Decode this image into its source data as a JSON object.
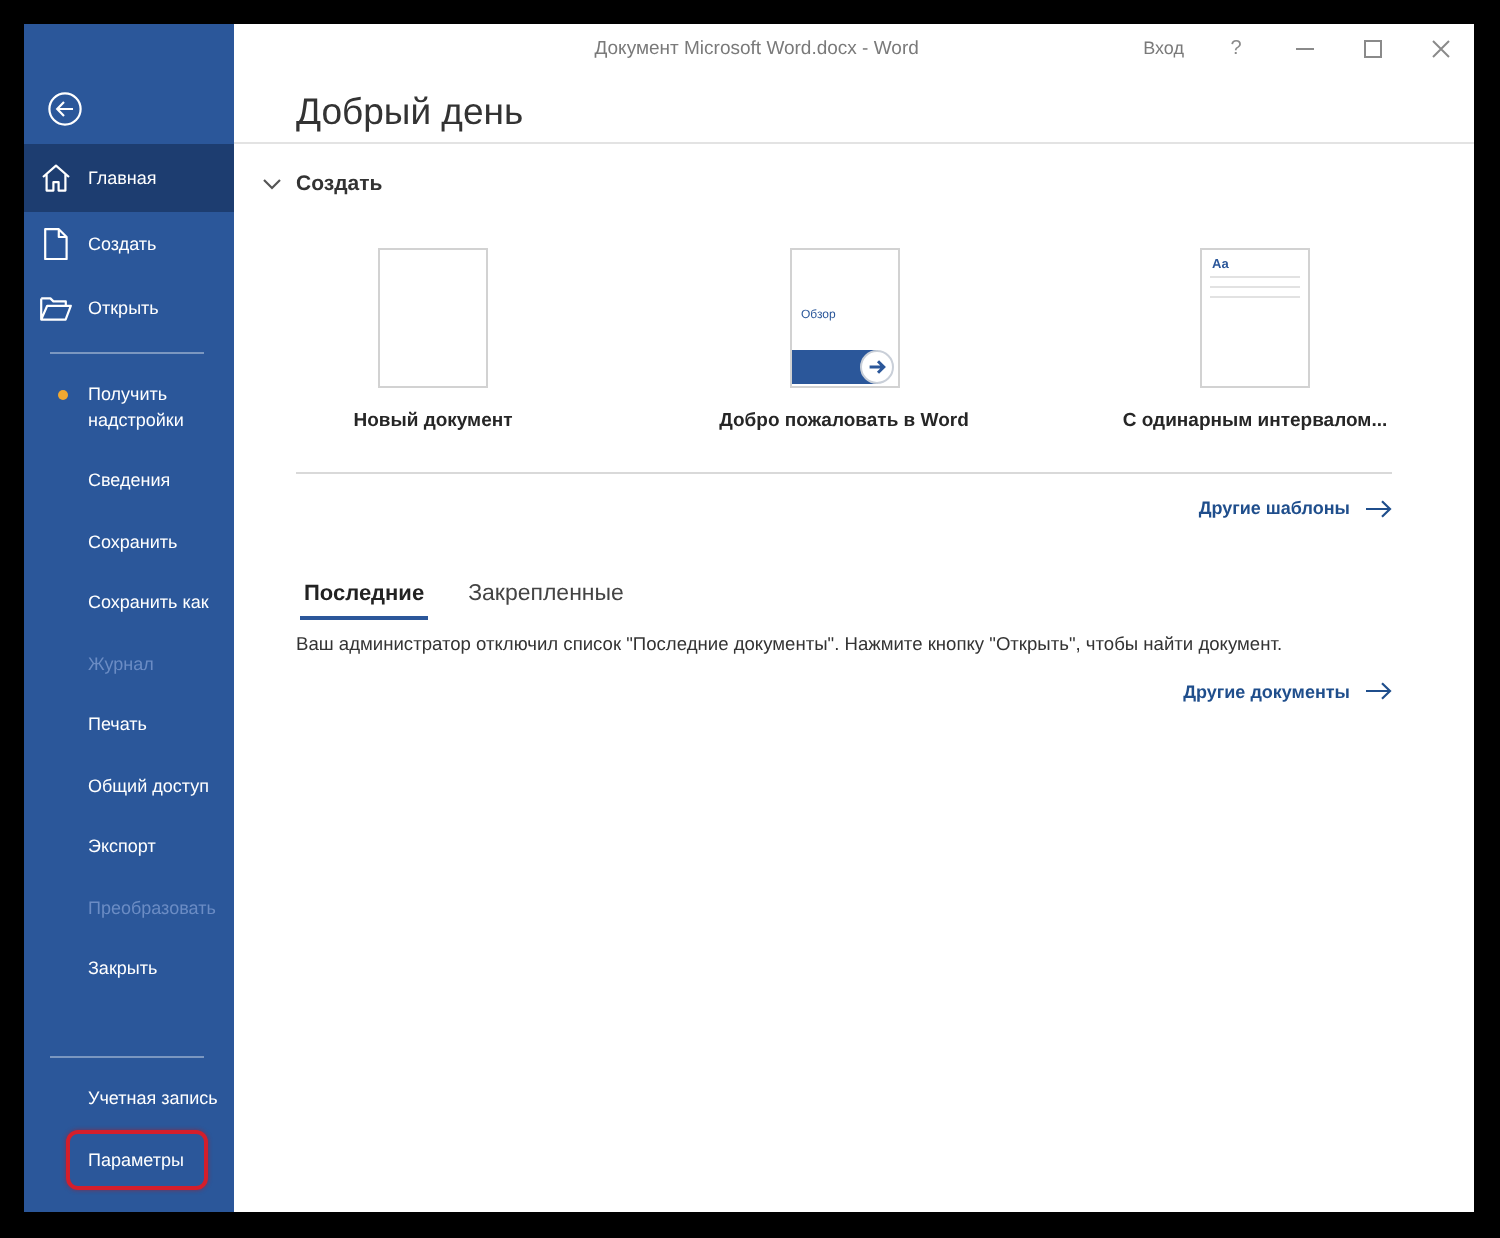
{
  "window": {
    "title": "Документ Microsoft Word.docx - Word",
    "sign_in": "Вход",
    "help": "?"
  },
  "sidebar": {
    "groups": [
      [
        {
          "label": "Главная",
          "kind": "home",
          "selected": true,
          "disabled": false
        },
        {
          "label": "Создать",
          "kind": "new",
          "selected": false,
          "disabled": false
        },
        {
          "label": "Открыть",
          "kind": "open",
          "selected": false,
          "disabled": false
        }
      ],
      [
        {
          "label": "Получить надстройки",
          "kind": "dot",
          "selected": false,
          "disabled": false
        },
        {
          "label": "Сведения",
          "kind": "plain",
          "selected": false,
          "disabled": false
        },
        {
          "label": "Сохранить",
          "kind": "plain",
          "selected": false,
          "disabled": false
        },
        {
          "label": "Сохранить как",
          "kind": "plain",
          "selected": false,
          "disabled": false
        },
        {
          "label": "Журнал",
          "kind": "plain",
          "selected": false,
          "disabled": true
        },
        {
          "label": "Печать",
          "kind": "plain",
          "selected": false,
          "disabled": false
        },
        {
          "label": "Общий доступ",
          "kind": "plain",
          "selected": false,
          "disabled": false
        },
        {
          "label": "Экспорт",
          "kind": "plain",
          "selected": false,
          "disabled": false
        },
        {
          "label": "Преобразовать",
          "kind": "plain",
          "selected": false,
          "disabled": true
        },
        {
          "label": "Закрыть",
          "kind": "plain",
          "selected": false,
          "disabled": false
        }
      ]
    ],
    "footer": [
      {
        "label": "Учетная запись",
        "kind": "plain",
        "selected": false,
        "disabled": false,
        "highlighted": false
      },
      {
        "label": "Параметры",
        "kind": "plain",
        "selected": false,
        "disabled": false,
        "highlighted": true
      }
    ]
  },
  "greeting": "Добрый день",
  "create": {
    "title": "Создать",
    "expanded": true,
    "templates": [
      {
        "label": "Новый документ",
        "kind": "blank"
      },
      {
        "label": "Добро пожаловать в Word",
        "kind": "tour",
        "thumb_text": "Обзор"
      },
      {
        "label": "С одинарным интервалом...",
        "kind": "single",
        "thumb_text": "Aa"
      }
    ],
    "more_link": "Другие шаблоны"
  },
  "documents": {
    "tabs": [
      {
        "label": "Последние",
        "selected": true
      },
      {
        "label": "Закрепленные",
        "selected": false
      }
    ],
    "message": "Ваш администратор отключил список \"Последние документы\". Нажмите кнопку \"Открыть\", чтобы найти документ.",
    "more_link": "Другие документы"
  }
}
